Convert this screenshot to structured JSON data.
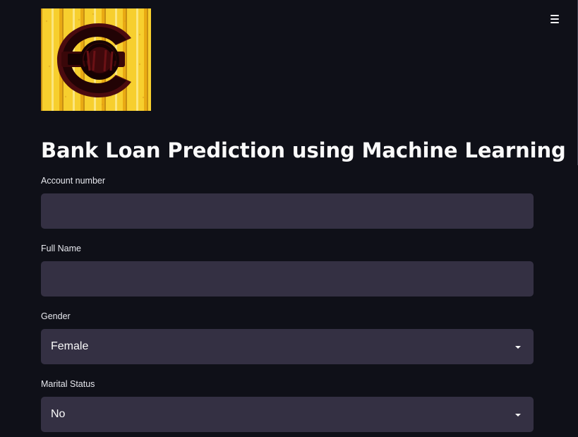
{
  "app": {
    "menu_icon": "hamburger-menu-icon",
    "logo_alt": "Logo"
  },
  "page": {
    "title": "Bank Loan Prediction using Machine Learning"
  },
  "form": {
    "account_number": {
      "label": "Account number",
      "value": "",
      "placeholder": ""
    },
    "full_name": {
      "label": "Full Name",
      "value": "",
      "placeholder": ""
    },
    "gender": {
      "label": "Gender",
      "selected": "Female"
    },
    "marital_status": {
      "label": "Marital Status",
      "selected": "No"
    }
  },
  "colors": {
    "background": "#0f1018",
    "field_background": "#343043",
    "text": "#fafafa",
    "logo_yellow": "#f8d435",
    "logo_dark_red": "#3b080b"
  }
}
